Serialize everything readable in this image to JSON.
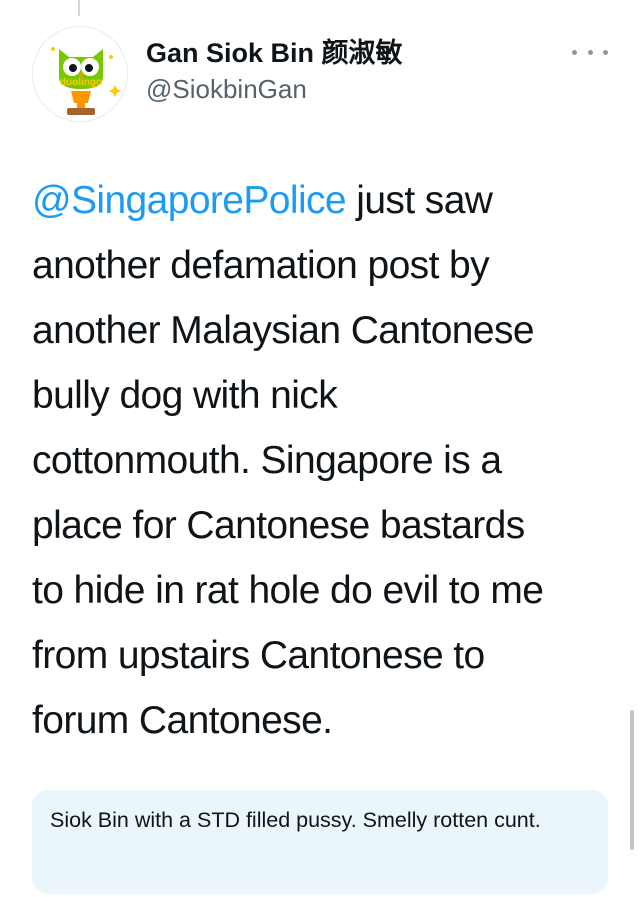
{
  "user": {
    "display_name": "Gan Siok Bin 颜淑敏",
    "handle": "@SiokbinGan",
    "avatar_label": "duolingo"
  },
  "tweet": {
    "mention": "@SingaporePolice",
    "lines": [
      " just saw",
      "another defamation post by",
      "another Malaysian Cantonese",
      "bully dog with nick",
      "cottonmouth. Singapore is a",
      "place for Cantonese bastards",
      "to hide in rat hole do evil to me",
      "from upstairs Cantonese to",
      "forum Cantonese."
    ]
  },
  "overlay": {
    "text": "Siok Bin with a STD filled pussy. Smelly rotten cunt."
  },
  "colors": {
    "link": "#1d9bf0",
    "text": "#0f1419",
    "secondary": "#536471",
    "box": "#eaf6fc",
    "owl_green": "#78c800",
    "owl_orange": "#ff9600"
  },
  "icons": {
    "avatar": "duolingo-owl-trophy",
    "more": "more-horizontal-icon"
  }
}
